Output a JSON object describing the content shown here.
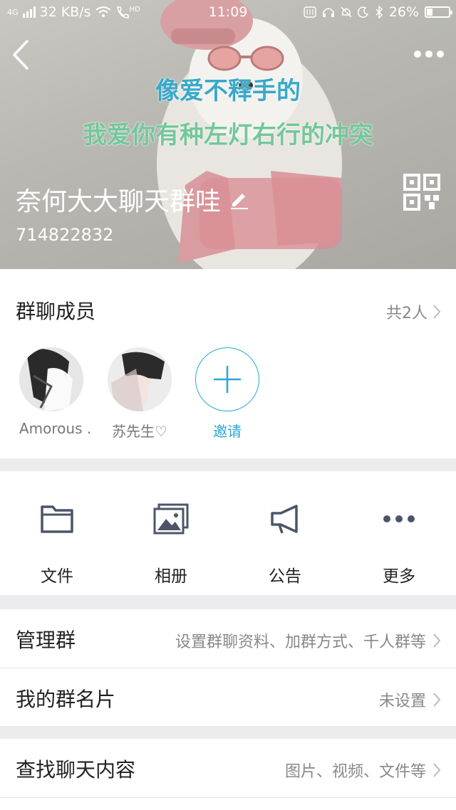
{
  "status_bar": {
    "network": "4G",
    "speed": "32 KB/s",
    "hd": "HD",
    "time": "11:09",
    "battery": "26%"
  },
  "lyrics": {
    "line1": "像爱不释手的",
    "line2": "我爱你有种左灯右行的冲突"
  },
  "group": {
    "name": "奈何大大聊天群哇",
    "id": "714822832"
  },
  "members": {
    "title": "群聊成员",
    "count": "共2人",
    "items": [
      {
        "name": "Amorous ."
      },
      {
        "name": "苏先生♡"
      }
    ],
    "invite_label": "邀请"
  },
  "tools": [
    {
      "label": "文件",
      "icon": "folder-icon"
    },
    {
      "label": "相册",
      "icon": "album-icon"
    },
    {
      "label": "公告",
      "icon": "announcement-icon"
    },
    {
      "label": "更多",
      "icon": "more-dots-icon"
    }
  ],
  "rows": {
    "manage": {
      "label": "管理群",
      "value": "设置群聊资料、加群方式、千人群等"
    },
    "card": {
      "label": "我的群名片",
      "value": "未设置"
    },
    "search": {
      "label": "查找聊天内容",
      "value": "图片、视频、文件等"
    }
  },
  "colors": {
    "accent": "#29a7d6",
    "icon_gray": "#4c5568",
    "lyric1": "#38a9c9",
    "lyric2": "#74c79a"
  }
}
